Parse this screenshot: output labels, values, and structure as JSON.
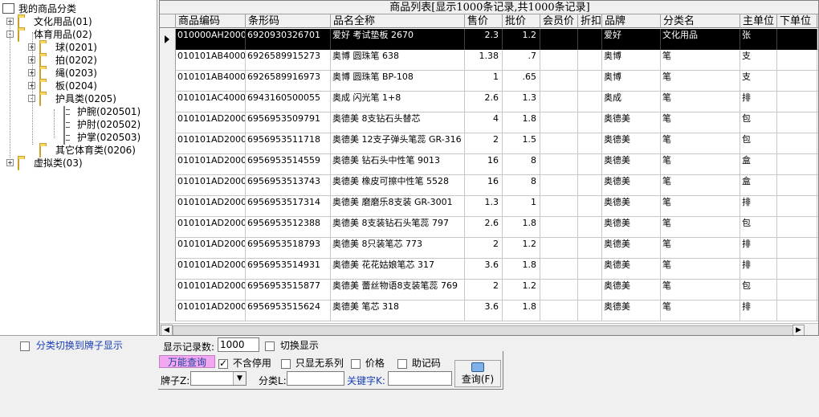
{
  "tree": {
    "root": "我的商品分类",
    "nodes": [
      {
        "label": "文化用品(01)",
        "exp": "+"
      },
      {
        "label": "体育用品(02)",
        "exp": "-"
      },
      {
        "label": "球(0201)",
        "exp": "+"
      },
      {
        "label": "拍(0202)",
        "exp": "+"
      },
      {
        "label": "绳(0203)",
        "exp": "+"
      },
      {
        "label": "板(0204)",
        "exp": "+"
      },
      {
        "label": "护具类(0205)",
        "exp": "-"
      },
      {
        "label": "护腕(020501)",
        "exp": ""
      },
      {
        "label": "护肘(020502)",
        "exp": ""
      },
      {
        "label": "护掌(020503)",
        "exp": ""
      },
      {
        "label": "其它体育类(0206)",
        "exp": ""
      },
      {
        "label": "虚拟类(03)",
        "exp": "+"
      }
    ]
  },
  "grid": {
    "title": "商品列表[显示1000条记录,共1000条记录]",
    "columns": [
      "商品编码",
      "条形码",
      "品名全称",
      "售价",
      "批价",
      "会员价",
      "折扣",
      "品牌",
      "分类名",
      "主单位",
      "下单位"
    ],
    "rows": [
      [
        "010000AH200001",
        "6920930326701",
        "爱好 考试垫板 2670",
        "2.3",
        "1.2",
        "",
        "",
        "爱好",
        "文化用品",
        "张",
        ""
      ],
      [
        "010101AB400001",
        "6926589915273",
        "奥博 圆珠笔 638",
        "1.38",
        ".7",
        "",
        "",
        "奥博",
        "笔",
        "支",
        ""
      ],
      [
        "010101AB400002",
        "6926589916973",
        "奥博 圆珠笔 BP-108",
        "1",
        ".65",
        "",
        "",
        "奥博",
        "笔",
        "支",
        ""
      ],
      [
        "010101AC400001",
        "6943160500055",
        "奥成 闪光笔 1+8",
        "2.6",
        "1.3",
        "",
        "",
        "奥成",
        "笔",
        "排",
        ""
      ],
      [
        "010101AD200001",
        "6956953509791",
        "奥德美 8支钻石头替芯",
        "4",
        "1.8",
        "",
        "",
        "奥德美",
        "笔",
        "包",
        ""
      ],
      [
        "010101AD200002",
        "6956953511718",
        "奥德美 12支子弹头笔蕊 GR-316",
        "2",
        "1.5",
        "",
        "",
        "奥德美",
        "笔",
        "包",
        ""
      ],
      [
        "010101AD200003",
        "6956953514559",
        "奥德美 钻石头中性笔 9013",
        "16",
        "8",
        "",
        "",
        "奥德美",
        "笔",
        "盒",
        ""
      ],
      [
        "010101AD200004",
        "6956953513743",
        "奥德美 橡皮可擦中性笔 5528",
        "16",
        "8",
        "",
        "",
        "奥德美",
        "笔",
        "盒",
        ""
      ],
      [
        "010101AD200005",
        "6956953517314",
        "奥德美 磨磨乐8支装 GR-3001",
        "1.3",
        "1",
        "",
        "",
        "奥德美",
        "笔",
        "排",
        ""
      ],
      [
        "010101AD200006",
        "6956953512388",
        "奥德美 8支装钻石头笔蕊 797",
        "2.6",
        "1.8",
        "",
        "",
        "奥德美",
        "笔",
        "包",
        ""
      ],
      [
        "010101AD200007",
        "6956953518793",
        "奥德美 8只装笔芯 773",
        "2",
        "1.2",
        "",
        "",
        "奥德美",
        "笔",
        "排",
        ""
      ],
      [
        "010101AD200008",
        "6956953514931",
        "奥德美 花花姑娘笔芯 317",
        "3.6",
        "1.8",
        "",
        "",
        "奥德美",
        "笔",
        "排",
        ""
      ],
      [
        "010101AD200009",
        "6956953515877",
        "奥德美 蕾丝物语8支装笔蕊 769",
        "2",
        "1.2",
        "",
        "",
        "奥德美",
        "笔",
        "包",
        ""
      ],
      [
        "010101AD200010",
        "6956953515624",
        "奥德美 笔芯 318",
        "3.6",
        "1.8",
        "",
        "",
        "奥德美",
        "笔",
        "排",
        ""
      ]
    ]
  },
  "controls": {
    "switch_brand": "分类切换到牌子显示",
    "record_count_label": "显示记录数:",
    "record_count_value": "1000",
    "switch_display": "切换显示",
    "universal_query": "万能查询",
    "exclude_disabled": "不含停用",
    "only_no_series": "只显无系列",
    "price": "价格",
    "mnemonic": "助记码",
    "brand_label": "牌子Z:",
    "category_label": "分类L:",
    "keyword_label": "关键字K:",
    "query_button": "查询(F)"
  }
}
